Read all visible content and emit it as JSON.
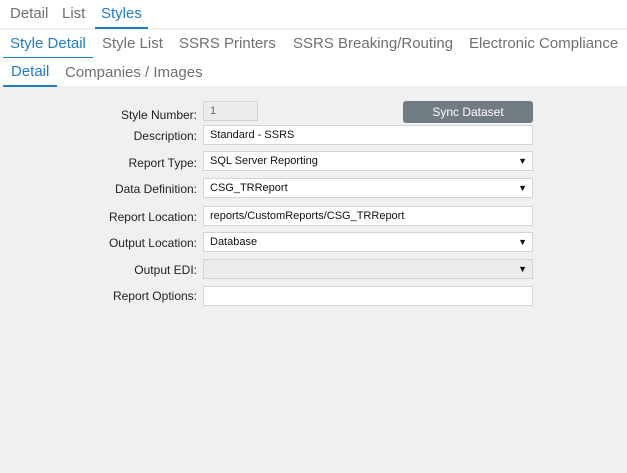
{
  "tabs_level1": [
    "Detail",
    "List",
    "Styles"
  ],
  "tabs_level2": [
    "Style Detail",
    "Style List",
    "SSRS Printers",
    "SSRS Breaking/Routing",
    "Electronic Compliance"
  ],
  "tabs_level3": [
    "Detail",
    "Companies / Images"
  ],
  "form": {
    "style_number": {
      "label": "Style Number:",
      "value": "1"
    },
    "sync_button": "Sync Dataset",
    "description": {
      "label": "Description:",
      "value": "Standard - SSRS"
    },
    "report_type": {
      "label": "Report Type:",
      "value": "SQL Server Reporting"
    },
    "data_definition": {
      "label": "Data Definition:",
      "value": "CSG_TRReport"
    },
    "report_location": {
      "label": "Report Location:",
      "value": "reports/CustomReports/CSG_TRReport"
    },
    "output_location": {
      "label": "Output Location:",
      "value": "Database"
    },
    "output_edi": {
      "label": "Output EDI:",
      "value": ""
    },
    "report_options": {
      "label": "Report Options:",
      "value": ""
    }
  },
  "icons": {
    "dropdown": "chevron-down-icon"
  }
}
